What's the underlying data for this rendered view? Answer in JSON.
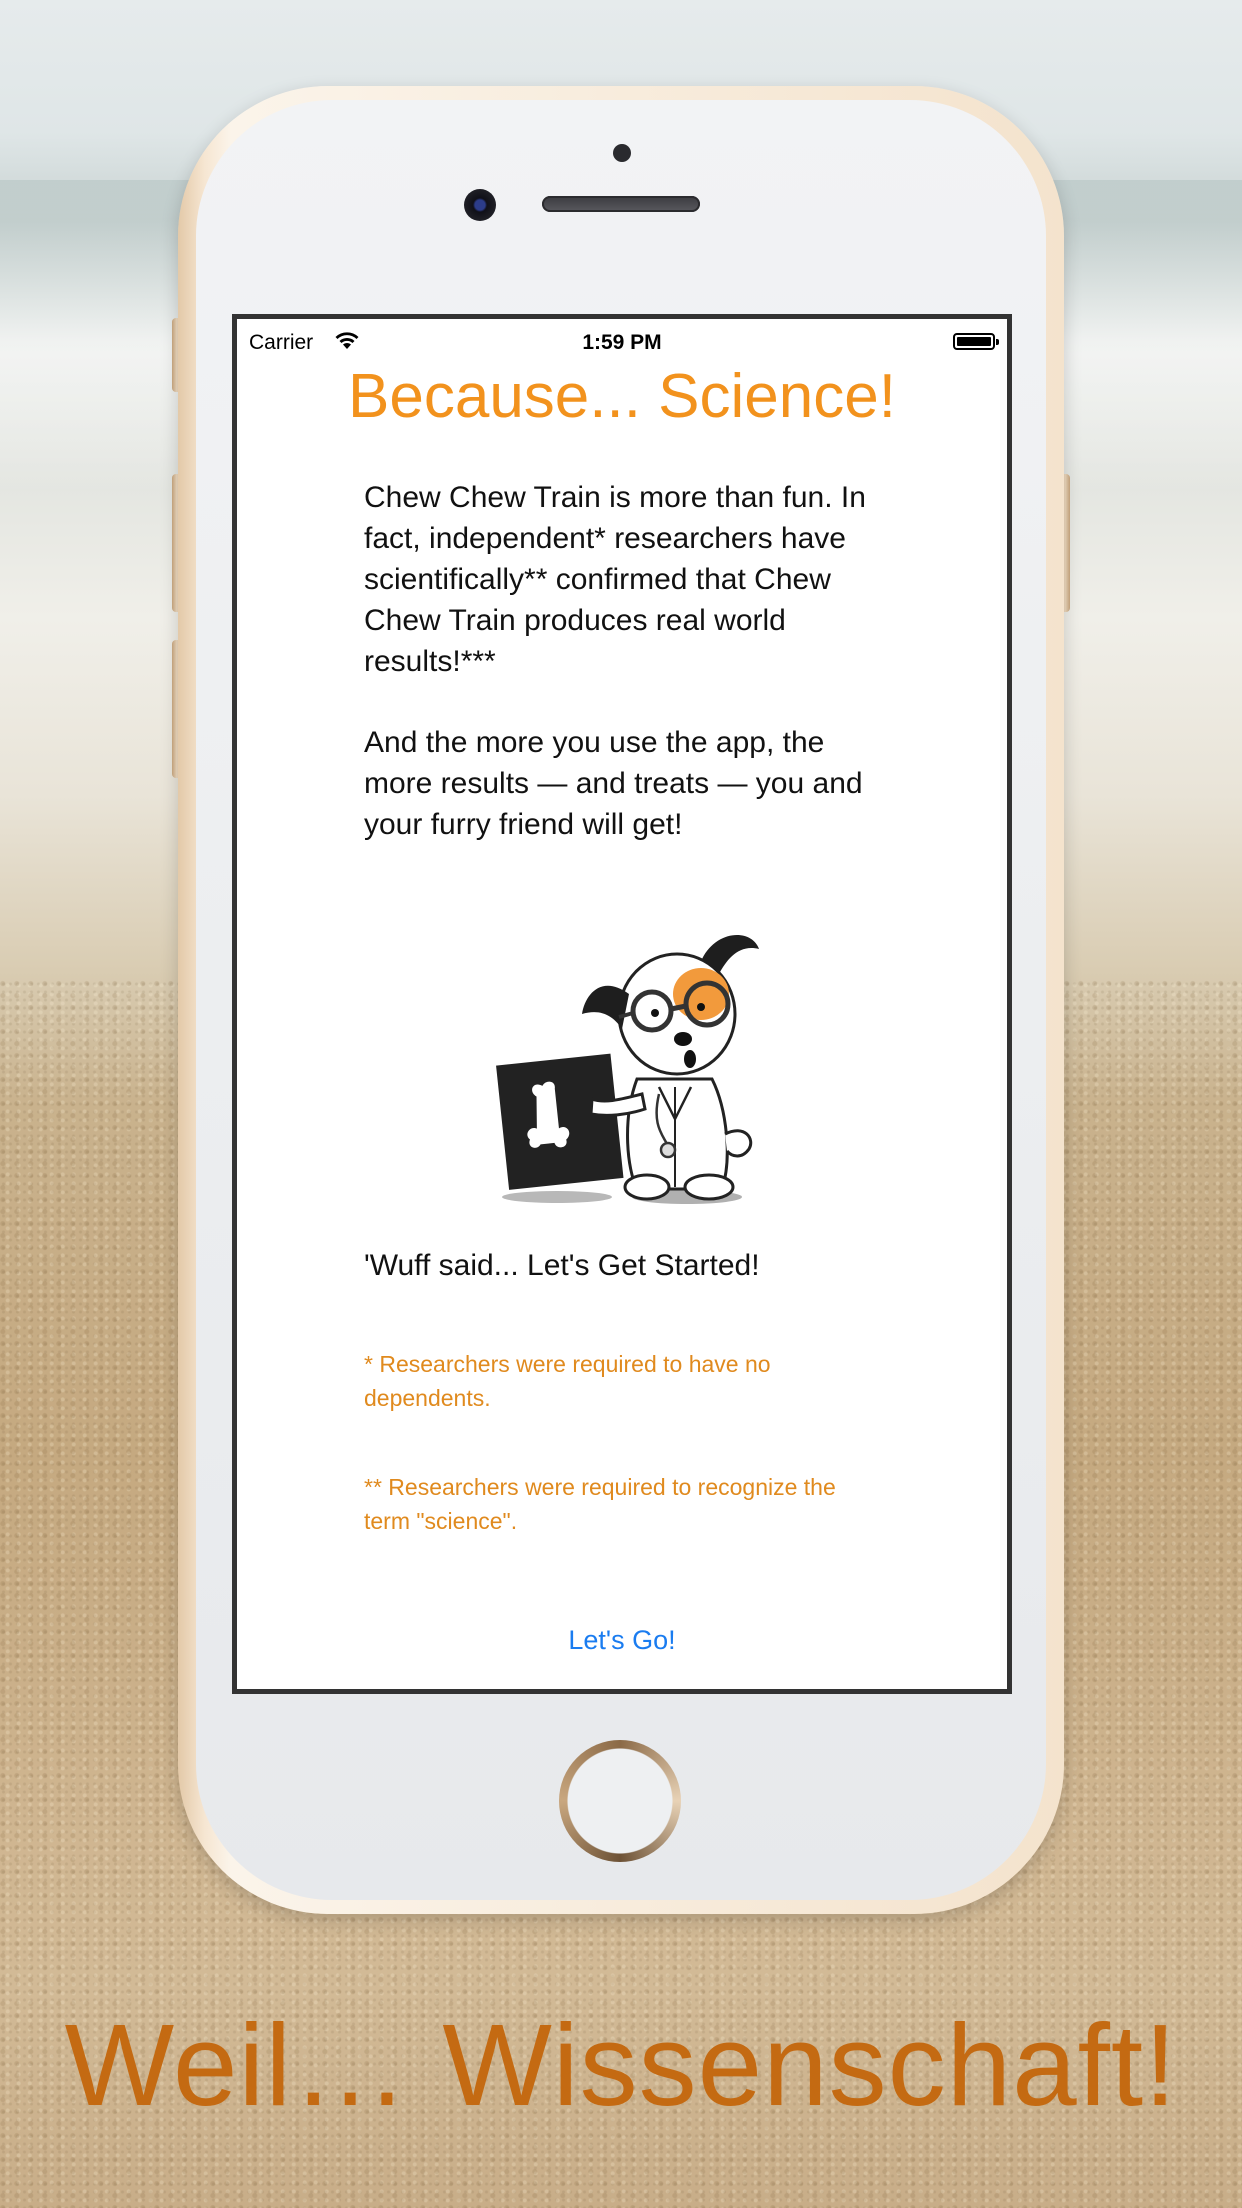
{
  "status_bar": {
    "carrier": "Carrier",
    "time": "1:59 PM"
  },
  "screen": {
    "title": "Because... Science!",
    "paragraph_1": "Chew Chew Train is more than fun. In fact, independent* researchers have scientifically** confirmed that Chew Chew Train produces real world results!***",
    "paragraph_2": "And the more you use the app, the more results — and treats — you and your furry friend will get!",
    "cta_text": "'Wuff said... Let's Get Started!",
    "footnote_1": "* Researchers were required to have no dependents.",
    "footnote_2": "** Researchers were required to recognize the term \"science\".",
    "button_label": "Let's Go!"
  },
  "caption": "Weil… Wissenschaft!",
  "colors": {
    "title": "#f2921d",
    "footnote": "#e08a1e",
    "button": "#1a7cf0",
    "caption": "#c46a12"
  },
  "icons": [
    "wifi-icon",
    "battery-icon",
    "dog-scientist-illustration"
  ]
}
